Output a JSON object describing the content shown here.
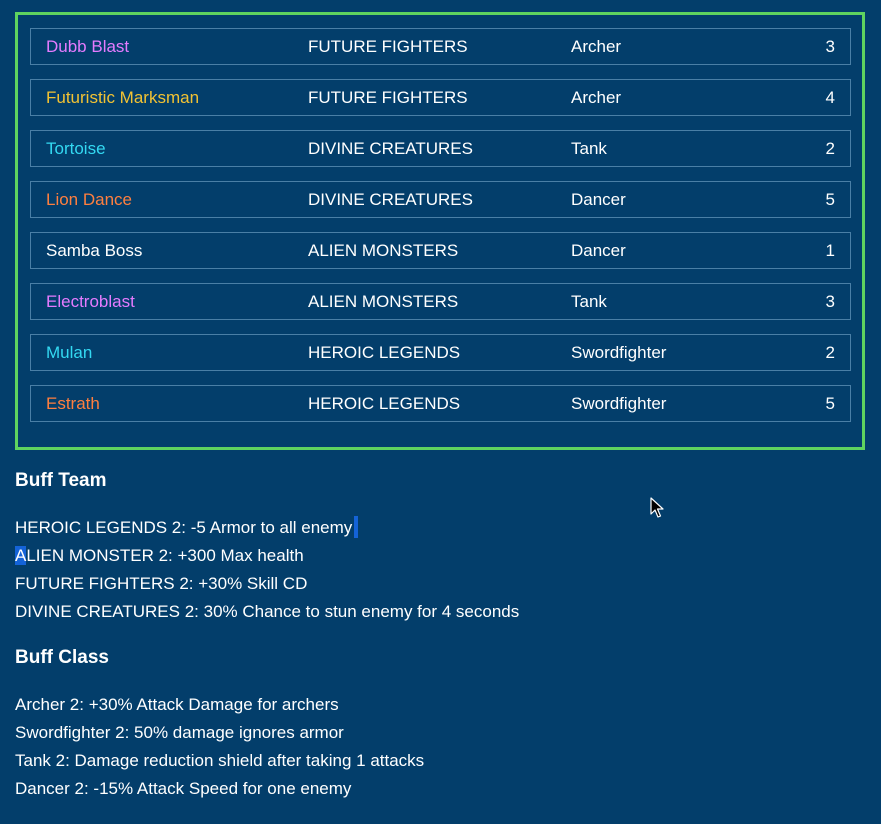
{
  "units": [
    {
      "name": "Dubb Blast",
      "team": "FUTURE FIGHTERS",
      "class": "Archer",
      "cost": "3",
      "color": "#e57bff"
    },
    {
      "name": "Futuristic Marksman",
      "team": "FUTURE FIGHTERS",
      "class": "Archer",
      "cost": "4",
      "color": "#f2c233"
    },
    {
      "name": "Tortoise",
      "team": "DIVINE CREATURES",
      "class": "Tank",
      "cost": "2",
      "color": "#33d9f2"
    },
    {
      "name": "Lion Dance",
      "team": "DIVINE CREATURES",
      "class": "Dancer",
      "cost": "5",
      "color": "#ff7f3f"
    },
    {
      "name": "Samba Boss",
      "team": "ALIEN MONSTERS",
      "class": "Dancer",
      "cost": "1",
      "color": "#ffffff"
    },
    {
      "name": "Electroblast",
      "team": "ALIEN MONSTERS",
      "class": "Tank",
      "cost": "3",
      "color": "#e57bff"
    },
    {
      "name": "Mulan",
      "team": "HEROIC LEGENDS",
      "class": "Swordfighter",
      "cost": "2",
      "color": "#33d9f2"
    },
    {
      "name": "Estrath",
      "team": "HEROIC LEGENDS",
      "class": "Swordfighter",
      "cost": "5",
      "color": "#ff7f3f"
    }
  ],
  "buff_team": {
    "title": "Buff Team",
    "lines": [
      "HEROIC LEGENDS 2: -5 Armor to all enemy",
      "ALIEN MONSTER 2: +300 Max health",
      "FUTURE FIGHTERS 2: +30% Skill CD",
      "DIVINE CREATURES 2: 30% Chance to stun enemy for 4 seconds"
    ]
  },
  "buff_class": {
    "title": "Buff Class",
    "lines": [
      "Archer 2: +30% Attack Damage for archers",
      "Swordfighter 2: 50% damage ignores armor",
      "Tank 2: Damage reduction shield after taking 1 attacks",
      "Dancer 2: -15% Attack Speed for one enemy"
    ]
  },
  "colors": {
    "background": "#033e6b",
    "roster_border": "#5fd35f",
    "row_border": "#4a7fa6",
    "selection": "#1463d8"
  },
  "icons": {
    "cursor": "mouse-pointer-icon"
  }
}
